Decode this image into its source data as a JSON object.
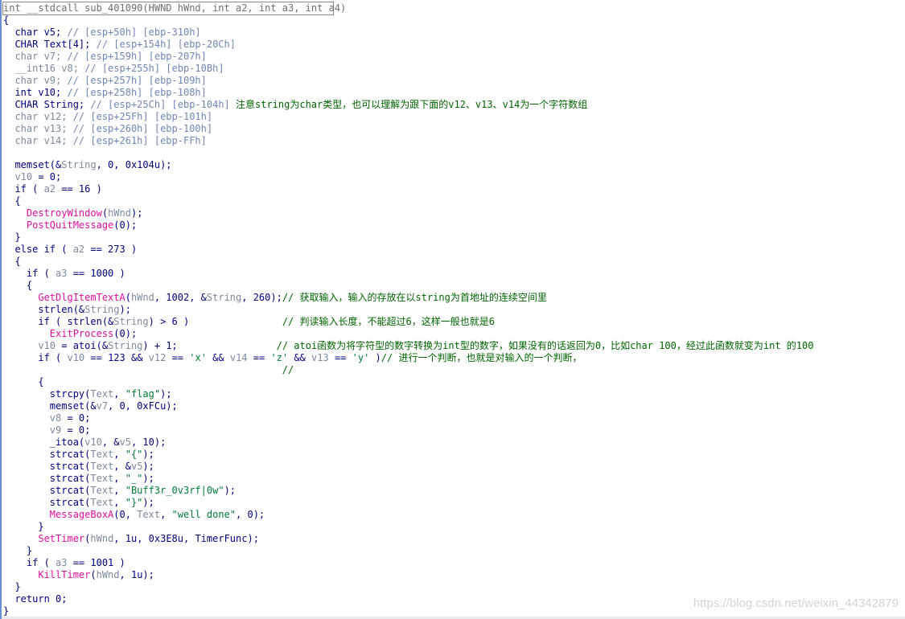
{
  "watermark": "https://blog.csdn.net/weixin_44342879",
  "colors": {
    "keyword": "#000080",
    "variable": "#7a8aa0",
    "comment": "#6f86b5",
    "function_call": "#e0109a",
    "string_literal": "#007a38",
    "note": "#006400"
  },
  "lines": [
    [
      {
        "c": "t-gray",
        "t": "int __stdcall sub_401090(HWND hWnd, int a2, int a3, int a4)"
      }
    ],
    [
      {
        "c": "t-plain",
        "t": "{"
      }
    ],
    [
      {
        "c": "t-plain",
        "t": "  char v5; "
      },
      {
        "c": "t-cmt",
        "t": "// [esp+50h] [ebp-310h]"
      }
    ],
    [
      {
        "c": "t-plain",
        "t": "  CHAR Text[4]; "
      },
      {
        "c": "t-cmt",
        "t": "// [esp+154h] [ebp-20Ch]"
      }
    ],
    [
      {
        "c": "t-var",
        "t": "  char v7; "
      },
      {
        "c": "t-cmt",
        "t": "// [esp+159h] [ebp-207h]"
      }
    ],
    [
      {
        "c": "t-var",
        "t": "  __int16 v8; "
      },
      {
        "c": "t-cmt",
        "t": "// [esp+255h] [ebp-10Bh]"
      }
    ],
    [
      {
        "c": "t-var",
        "t": "  char v9; "
      },
      {
        "c": "t-cmt",
        "t": "// [esp+257h] [ebp-109h]"
      }
    ],
    [
      {
        "c": "t-plain",
        "t": "  int v10; "
      },
      {
        "c": "t-cmt",
        "t": "// [esp+258h] [ebp-108h]"
      }
    ],
    [
      {
        "c": "t-plain",
        "t": "  CHAR String; "
      },
      {
        "c": "t-cmt",
        "t": "// [esp+25Ch] [ebp-104h] "
      },
      {
        "c": "t-note",
        "t": "注意string为char类型，也可以理解为跟下面的v12、v13、v14为一个字符数组"
      }
    ],
    [
      {
        "c": "t-var",
        "t": "  char v12; "
      },
      {
        "c": "t-cmt",
        "t": "// [esp+25Fh] [ebp-101h]"
      }
    ],
    [
      {
        "c": "t-var",
        "t": "  char v13; "
      },
      {
        "c": "t-cmt",
        "t": "// [esp+260h] [ebp-100h]"
      }
    ],
    [
      {
        "c": "t-var",
        "t": "  char v14; "
      },
      {
        "c": "t-cmt",
        "t": "// [esp+261h] [ebp-FFh]"
      }
    ],
    [
      {
        "c": "t-plain",
        "t": ""
      }
    ],
    [
      {
        "c": "t-plain",
        "t": "  memset(&"
      },
      {
        "c": "t-var",
        "t": "String"
      },
      {
        "c": "t-plain",
        "t": ", 0, 0x104u);"
      }
    ],
    [
      {
        "c": "t-var",
        "t": "  v10"
      },
      {
        "c": "t-plain",
        "t": " = 0;"
      }
    ],
    [
      {
        "c": "t-plain",
        "t": "  if ( "
      },
      {
        "c": "t-var",
        "t": "a2"
      },
      {
        "c": "t-plain",
        "t": " == 16 )"
      }
    ],
    [
      {
        "c": "t-plain",
        "t": "  {"
      }
    ],
    [
      {
        "c": "t-func",
        "t": "    DestroyWindow"
      },
      {
        "c": "t-plain",
        "t": "("
      },
      {
        "c": "t-var",
        "t": "hWnd"
      },
      {
        "c": "t-plain",
        "t": ");"
      }
    ],
    [
      {
        "c": "t-func",
        "t": "    PostQuitMessage"
      },
      {
        "c": "t-plain",
        "t": "(0);"
      }
    ],
    [
      {
        "c": "t-plain",
        "t": "  }"
      }
    ],
    [
      {
        "c": "t-plain",
        "t": "  else if ( "
      },
      {
        "c": "t-var",
        "t": "a2"
      },
      {
        "c": "t-plain",
        "t": " == 273 )"
      }
    ],
    [
      {
        "c": "t-plain",
        "t": "  {"
      }
    ],
    [
      {
        "c": "t-plain",
        "t": "    if ( "
      },
      {
        "c": "t-var",
        "t": "a3"
      },
      {
        "c": "t-plain",
        "t": " == 1000 )"
      }
    ],
    [
      {
        "c": "t-plain",
        "t": "    {"
      }
    ],
    [
      {
        "c": "t-func",
        "t": "      GetDlgItemTextA"
      },
      {
        "c": "t-plain",
        "t": "("
      },
      {
        "c": "t-var",
        "t": "hWnd"
      },
      {
        "c": "t-plain",
        "t": ", 1002, &"
      },
      {
        "c": "t-var",
        "t": "String"
      },
      {
        "c": "t-plain",
        "t": ", 260);"
      },
      {
        "c": "t-note",
        "t": "// 获取输入，输入的存放在以string为首地址的连续空间里"
      }
    ],
    [
      {
        "c": "t-plain",
        "t": "      strlen(&"
      },
      {
        "c": "t-var",
        "t": "String"
      },
      {
        "c": "t-plain",
        "t": ");"
      }
    ],
    [
      {
        "c": "t-plain",
        "t": "      if ( strlen(&"
      },
      {
        "c": "t-var",
        "t": "String"
      },
      {
        "c": "t-plain",
        "t": ") > 6 )                "
      },
      {
        "c": "t-note",
        "t": "// 判读输入长度，不能超过6，这样一般也就是6"
      }
    ],
    [
      {
        "c": "t-func",
        "t": "        ExitProcess"
      },
      {
        "c": "t-plain",
        "t": "(0);"
      }
    ],
    [
      {
        "c": "t-var",
        "t": "      v10"
      },
      {
        "c": "t-plain",
        "t": " = atoi(&"
      },
      {
        "c": "t-var",
        "t": "String"
      },
      {
        "c": "t-plain",
        "t": ") + 1;                 "
      },
      {
        "c": "t-note",
        "t": "// atoi函数为将字符型的数字转换为int型的数字，如果没有的话返回为0，比如char 100，经过此函数就变为int 的100"
      }
    ],
    [
      {
        "c": "t-plain",
        "t": "      if ( "
      },
      {
        "c": "t-var",
        "t": "v10"
      },
      {
        "c": "t-plain",
        "t": " == 123 && "
      },
      {
        "c": "t-var",
        "t": "v12"
      },
      {
        "c": "t-plain",
        "t": " == "
      },
      {
        "c": "t-str",
        "t": "'x'"
      },
      {
        "c": "t-plain",
        "t": " && "
      },
      {
        "c": "t-var",
        "t": "v14"
      },
      {
        "c": "t-plain",
        "t": " == "
      },
      {
        "c": "t-str",
        "t": "'z'"
      },
      {
        "c": "t-plain",
        "t": " && "
      },
      {
        "c": "t-var",
        "t": "v13"
      },
      {
        "c": "t-plain",
        "t": " == "
      },
      {
        "c": "t-str",
        "t": "'y'"
      },
      {
        "c": "t-plain",
        "t": " )"
      },
      {
        "c": "t-note",
        "t": "// 进行一个判断，也就是对输入的一个判断，"
      }
    ],
    [
      {
        "c": "t-plain",
        "t": "                                                "
      },
      {
        "c": "t-note",
        "t": "//"
      }
    ],
    [
      {
        "c": "t-plain",
        "t": "      {"
      }
    ],
    [
      {
        "c": "t-plain",
        "t": "        strcpy("
      },
      {
        "c": "t-var",
        "t": "Text"
      },
      {
        "c": "t-plain",
        "t": ", "
      },
      {
        "c": "t-str",
        "t": "\"flag\""
      },
      {
        "c": "t-plain",
        "t": ");"
      }
    ],
    [
      {
        "c": "t-plain",
        "t": "        memset(&"
      },
      {
        "c": "t-var",
        "t": "v7"
      },
      {
        "c": "t-plain",
        "t": ", 0, 0xFCu);"
      }
    ],
    [
      {
        "c": "t-var",
        "t": "        v8"
      },
      {
        "c": "t-plain",
        "t": " = 0;"
      }
    ],
    [
      {
        "c": "t-var",
        "t": "        v9"
      },
      {
        "c": "t-plain",
        "t": " = 0;"
      }
    ],
    [
      {
        "c": "t-plain",
        "t": "        _itoa("
      },
      {
        "c": "t-var",
        "t": "v10"
      },
      {
        "c": "t-plain",
        "t": ", &"
      },
      {
        "c": "t-var",
        "t": "v5"
      },
      {
        "c": "t-plain",
        "t": ", 10);"
      }
    ],
    [
      {
        "c": "t-plain",
        "t": "        strcat("
      },
      {
        "c": "t-var",
        "t": "Text"
      },
      {
        "c": "t-plain",
        "t": ", "
      },
      {
        "c": "t-str",
        "t": "\"{\""
      },
      {
        "c": "t-plain",
        "t": ");"
      }
    ],
    [
      {
        "c": "t-plain",
        "t": "        strcat("
      },
      {
        "c": "t-var",
        "t": "Text"
      },
      {
        "c": "t-plain",
        "t": ", &"
      },
      {
        "c": "t-var",
        "t": "v5"
      },
      {
        "c": "t-plain",
        "t": ");"
      }
    ],
    [
      {
        "c": "t-plain",
        "t": "        strcat("
      },
      {
        "c": "t-var",
        "t": "Text"
      },
      {
        "c": "t-plain",
        "t": ", "
      },
      {
        "c": "t-str",
        "t": "\"_\""
      },
      {
        "c": "t-plain",
        "t": ");"
      }
    ],
    [
      {
        "c": "t-plain",
        "t": "        strcat("
      },
      {
        "c": "t-var",
        "t": "Text"
      },
      {
        "c": "t-plain",
        "t": ", "
      },
      {
        "c": "t-str",
        "t": "\"Buff3r_0v3rf|0w\""
      },
      {
        "c": "t-plain",
        "t": ");"
      }
    ],
    [
      {
        "c": "t-plain",
        "t": "        strcat("
      },
      {
        "c": "t-var",
        "t": "Text"
      },
      {
        "c": "t-plain",
        "t": ", "
      },
      {
        "c": "t-str",
        "t": "\"}\""
      },
      {
        "c": "t-plain",
        "t": ");"
      }
    ],
    [
      {
        "c": "t-func",
        "t": "        MessageBoxA"
      },
      {
        "c": "t-plain",
        "t": "(0, "
      },
      {
        "c": "t-var",
        "t": "Text"
      },
      {
        "c": "t-plain",
        "t": ", "
      },
      {
        "c": "t-str",
        "t": "\"well done\""
      },
      {
        "c": "t-plain",
        "t": ", 0);"
      }
    ],
    [
      {
        "c": "t-plain",
        "t": "      }"
      }
    ],
    [
      {
        "c": "t-func",
        "t": "      SetTimer"
      },
      {
        "c": "t-plain",
        "t": "("
      },
      {
        "c": "t-var",
        "t": "hWnd"
      },
      {
        "c": "t-plain",
        "t": ", 1u, 0x3E8u, TimerFunc);"
      }
    ],
    [
      {
        "c": "t-plain",
        "t": "    }"
      }
    ],
    [
      {
        "c": "t-plain",
        "t": "    if ( "
      },
      {
        "c": "t-var",
        "t": "a3"
      },
      {
        "c": "t-plain",
        "t": " == 1001 )"
      }
    ],
    [
      {
        "c": "t-func",
        "t": "      KillTimer"
      },
      {
        "c": "t-plain",
        "t": "("
      },
      {
        "c": "t-var",
        "t": "hWnd"
      },
      {
        "c": "t-plain",
        "t": ", 1u);"
      }
    ],
    [
      {
        "c": "t-plain",
        "t": "  }"
      }
    ],
    [
      {
        "c": "t-plain",
        "t": "  return 0;"
      }
    ],
    [
      {
        "c": "t-plain",
        "t": "}"
      }
    ]
  ]
}
